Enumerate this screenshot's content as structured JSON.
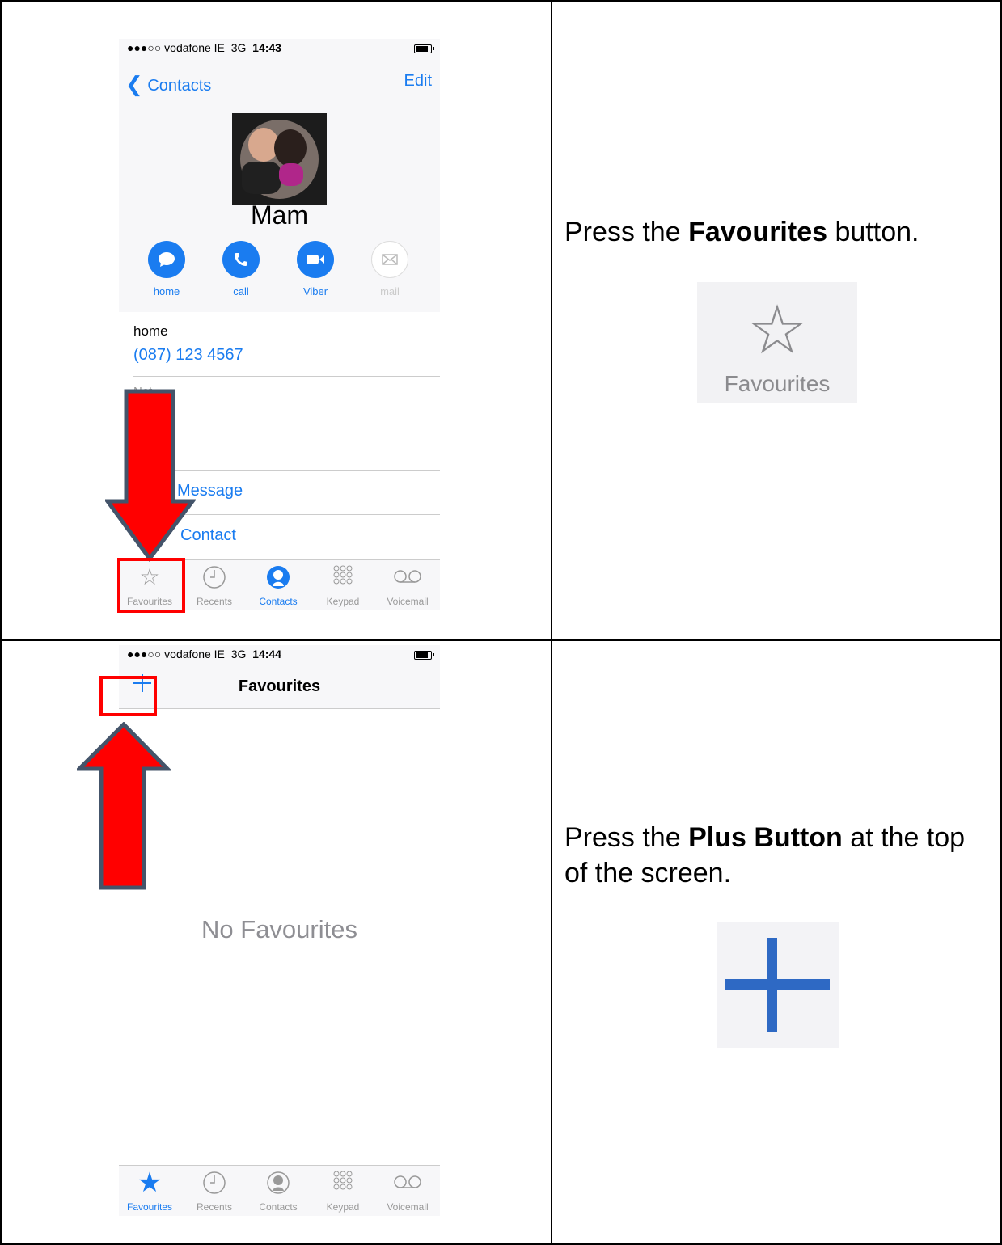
{
  "panel1": {
    "status": {
      "dots": "●●●○○",
      "carrier": "vodafone IE",
      "network": "3G",
      "time": "14:43"
    },
    "nav": {
      "back": "Contacts",
      "edit": "Edit"
    },
    "contact_name": "Mam",
    "actions": [
      {
        "label": "home",
        "icon": "message-icon"
      },
      {
        "label": "call",
        "icon": "phone-icon"
      },
      {
        "label": "Viber",
        "icon": "video-icon"
      },
      {
        "label": "mail",
        "icon": "mail-icon"
      }
    ],
    "phone_label": "home",
    "phone_number": "(087) 123 4567",
    "notes_partial": "Not",
    "send_message": "Message",
    "share_contact": "Contact",
    "tabs": [
      "Favourites",
      "Recents",
      "Contacts",
      "Keypad",
      "Voicemail"
    ]
  },
  "panel2": {
    "status": {
      "dots": "●●●○○",
      "carrier": "vodafone IE",
      "network": "3G",
      "time": "14:44"
    },
    "title": "Favourites",
    "empty": "No Favourites",
    "tabs": [
      "Favourites",
      "Recents",
      "Contacts",
      "Keypad",
      "Voicemail"
    ]
  },
  "instructions": {
    "step1": {
      "pre": "Press the ",
      "bold": "Favourites",
      "post": " button."
    },
    "step1_icon_label": "Favourites",
    "step2": {
      "pre": "Press the ",
      "bold": "Plus Button",
      "post": " at the top of the screen."
    }
  },
  "colors": {
    "ios_blue": "#1a7cf0",
    "arrow_red": "#ff0000",
    "arrow_border": "#44546a"
  }
}
